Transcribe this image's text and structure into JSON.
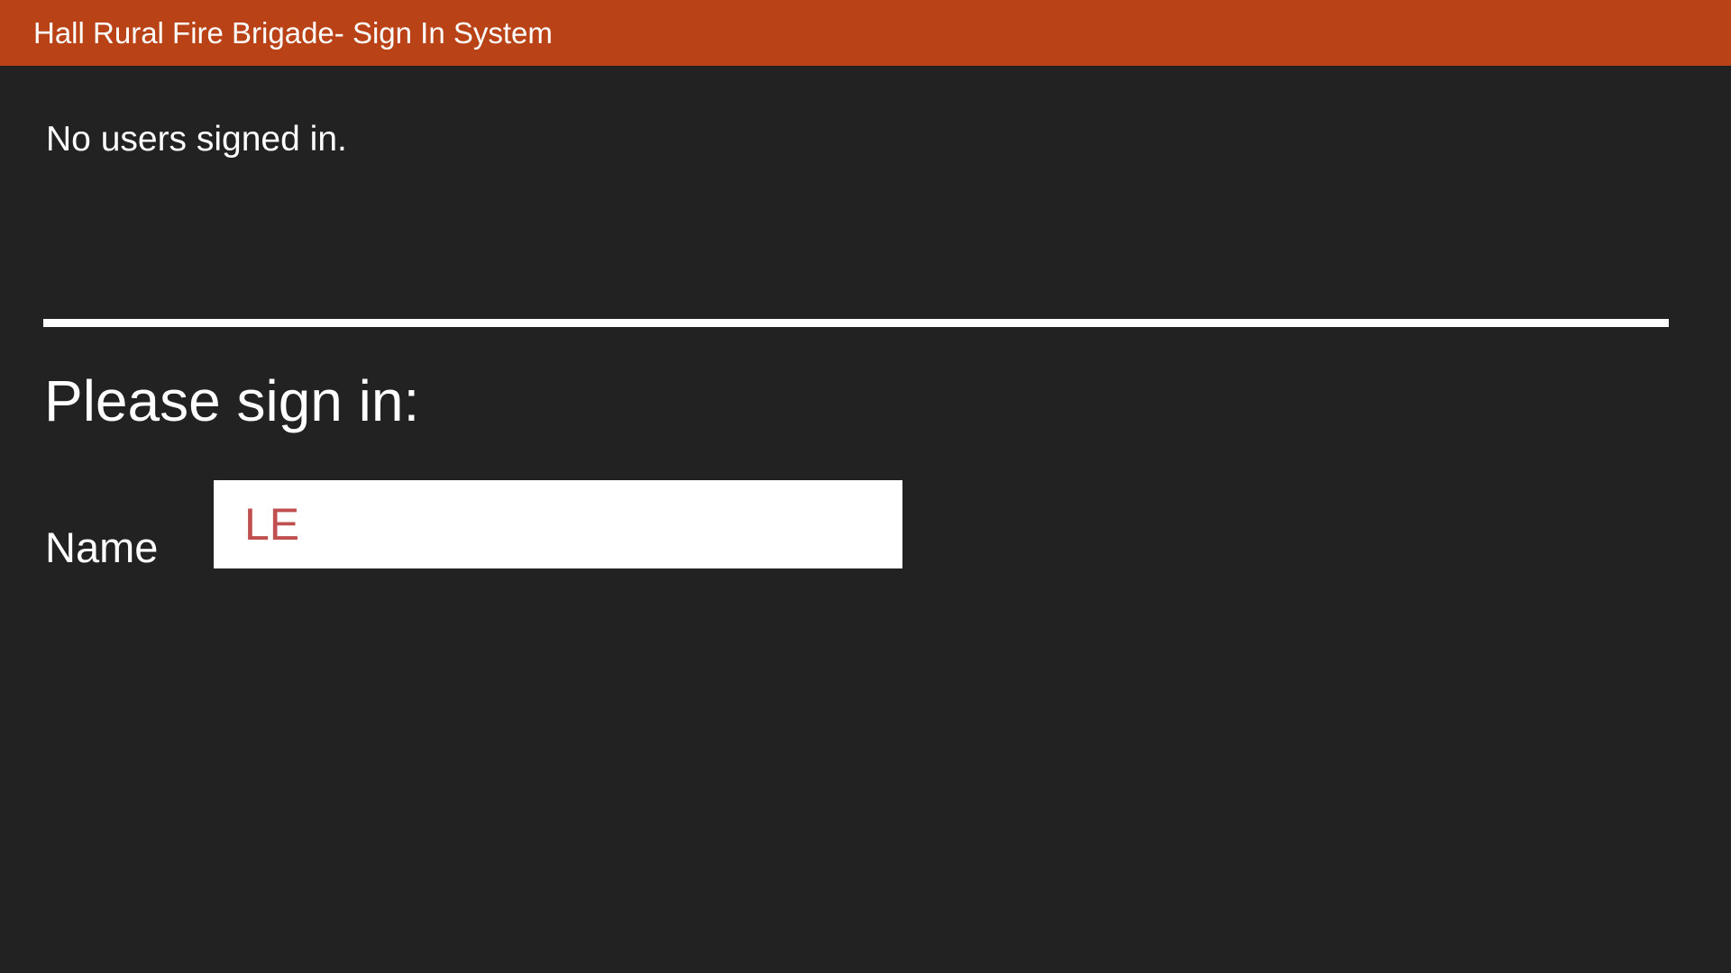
{
  "header": {
    "title": "Hall Rural Fire Brigade- Sign In System"
  },
  "status": {
    "message": "No users signed in."
  },
  "signin": {
    "heading": "Please sign in:",
    "name_label": "Name",
    "name_value": "LE"
  },
  "colors": {
    "header_bg": "#b94317",
    "page_bg": "#222222",
    "text": "#ffffff",
    "input_text": "#c0504f"
  }
}
